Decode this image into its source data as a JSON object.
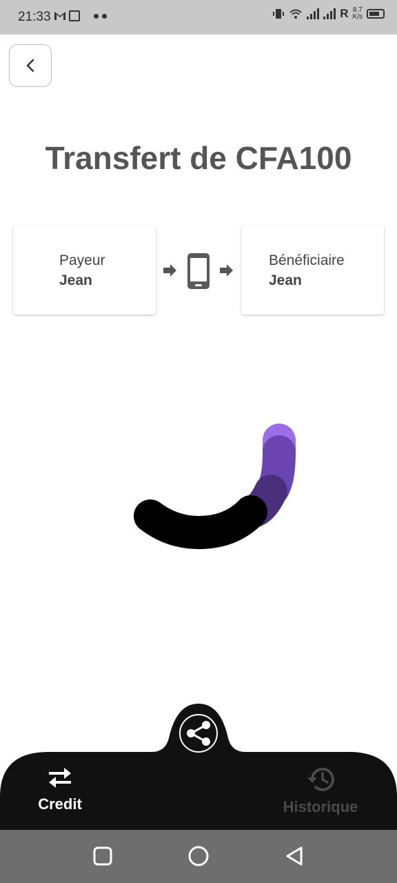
{
  "status_bar": {
    "time": "21:33",
    "net_speed_value": "8.7",
    "net_speed_unit": "K/s",
    "roaming_letter": "R",
    "icons": [
      "gmail-icon",
      "app-icon",
      "more-dots-icon",
      "vibrate-icon",
      "wifi-icon",
      "signal-icon",
      "signal-icon",
      "battery-icon"
    ]
  },
  "header": {
    "back_icon": "chevron-left-icon"
  },
  "transfer": {
    "title": "Transfert de CFA100",
    "payer": {
      "role": "Payeur",
      "name": "Jean"
    },
    "beneficiary": {
      "role": "Bénéficiaire",
      "name": "Jean"
    },
    "middle_icon": "smartphone-icon"
  },
  "loader": {
    "colors": [
      "#9a6ee6",
      "#6a44b0",
      "#4a2f7d",
      "#000000"
    ]
  },
  "bottom_nav": {
    "share_icon": "share-icon",
    "items": [
      {
        "label": "Credit",
        "icon": "swap-arrows-icon",
        "active": true
      },
      {
        "label": "Historique",
        "icon": "history-icon",
        "active": false
      }
    ],
    "colors": {
      "bar": "#111111",
      "active": "#ffffff",
      "inactive": "#4a4a4a"
    }
  },
  "system_nav": {
    "buttons": [
      "recents-square-icon",
      "home-circle-icon",
      "back-triangle-icon"
    ]
  }
}
